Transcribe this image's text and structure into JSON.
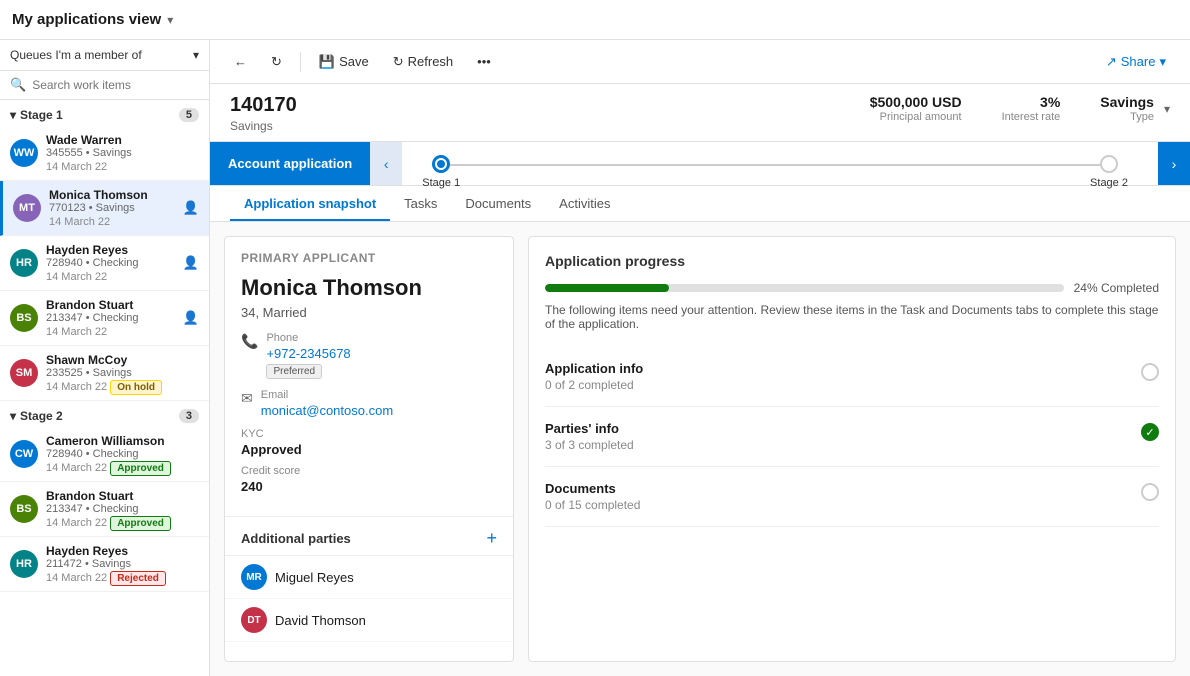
{
  "topbar": {
    "title": "My applications view",
    "chevron": "▾"
  },
  "sidebar": {
    "queue_label": "Queues I'm a member of",
    "search_placeholder": "Search work items",
    "stages": [
      {
        "name": "Stage 1",
        "count": 5,
        "items": [
          {
            "id": "ww",
            "initials": "WW",
            "color": "#0078d4",
            "name": "Wade Warren",
            "sub": "345555 • Savings",
            "date": "14 March 22",
            "badge": null
          },
          {
            "id": "mt",
            "initials": "MT",
            "color": "#8764b8",
            "name": "Monica Thomson",
            "sub": "770123 • Savings",
            "date": "14 March 22",
            "badge": null,
            "active": true
          },
          {
            "id": "hr",
            "initials": "HR",
            "color": "#038387",
            "name": "Hayden Reyes",
            "sub": "728940 • Checking",
            "date": "14 March 22",
            "badge": null
          },
          {
            "id": "bs",
            "initials": "BS",
            "color": "#498205",
            "name": "Brandon Stuart",
            "sub": "213347 • Checking",
            "date": "14 March 22",
            "badge": null
          },
          {
            "id": "sm",
            "initials": "SM",
            "color": "#c43148",
            "name": "Shawn McCoy",
            "sub": "233525 • Savings",
            "date": "14 March 22",
            "badge": "On hold",
            "badge_type": "onhold"
          }
        ]
      },
      {
        "name": "Stage 2",
        "count": 3,
        "items": [
          {
            "id": "cw",
            "initials": "CW",
            "color": "#0078d4",
            "name": "Cameron Williamson",
            "sub": "728940 • Checking",
            "date": "14 March 22",
            "badge": "Approved",
            "badge_type": "approved"
          },
          {
            "id": "bs2",
            "initials": "BS",
            "color": "#498205",
            "name": "Brandon Stuart",
            "sub": "213347 • Checking",
            "date": "14 March 22",
            "badge": "Approved",
            "badge_type": "approved"
          },
          {
            "id": "hr2",
            "initials": "HR",
            "color": "#038387",
            "name": "Hayden Reyes",
            "sub": "211472 • Savings",
            "date": "14 March 22",
            "badge": "Rejected",
            "badge_type": "rejected"
          }
        ]
      }
    ]
  },
  "toolbar": {
    "back_label": "",
    "refresh_icon": "↻",
    "save_label": "Save",
    "refresh_label": "Refresh",
    "more_label": "•••",
    "share_label": "Share"
  },
  "record": {
    "id": "140170",
    "type": "Savings",
    "principal_amount": "$500,000 USD",
    "principal_label": "Principal amount",
    "interest_rate": "3%",
    "interest_label": "Interest rate",
    "savings_type": "Savings",
    "savings_label": "Type"
  },
  "stages": {
    "active_label": "Account application",
    "stage1_label": "Stage 1",
    "stage2_label": "Stage 2"
  },
  "tabs": [
    {
      "id": "snapshot",
      "label": "Application snapshot",
      "active": true
    },
    {
      "id": "tasks",
      "label": "Tasks"
    },
    {
      "id": "documents",
      "label": "Documents"
    },
    {
      "id": "activities",
      "label": "Activities"
    }
  ],
  "primary_applicant": {
    "section_title": "Primary applicant",
    "name": "Monica Thomson",
    "sub": "34, Married",
    "phone_label": "Phone",
    "phone_value": "+972-2345678",
    "phone_badge": "Preferred",
    "email_label": "Email",
    "email_value": "monicat@contoso.com",
    "kyc_label": "KYC",
    "kyc_value": "Approved",
    "credit_label": "Credit score",
    "credit_value": "240"
  },
  "additional_parties": {
    "title": "Additional parties",
    "add_icon": "+",
    "parties": [
      {
        "initials": "MR",
        "color": "#0078d4",
        "name": "Miguel Reyes"
      },
      {
        "initials": "DT",
        "color": "#c43148",
        "name": "David Thomson"
      }
    ]
  },
  "progress": {
    "title": "Application progress",
    "pct": 24,
    "pct_label": "24% Completed",
    "note": "The following items need your attention. Review these items in the Task and Documents tabs to complete this stage of the application.",
    "items": [
      {
        "name": "Application info",
        "sub": "0 of 2 completed",
        "done": false
      },
      {
        "name": "Parties' info",
        "sub": "3 of 3 completed",
        "done": true
      },
      {
        "name": "Documents",
        "sub": "0 of 15 completed",
        "done": false
      }
    ]
  }
}
